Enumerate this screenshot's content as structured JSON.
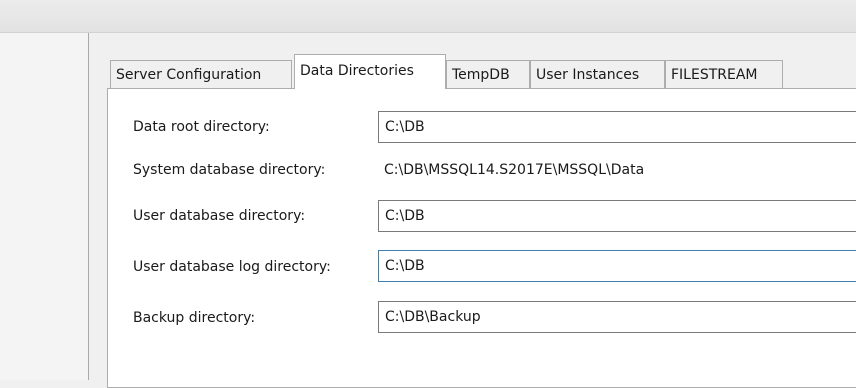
{
  "tabs": [
    {
      "id": "server-configuration",
      "label": "Server Configuration",
      "active": false
    },
    {
      "id": "data-directories",
      "label": "Data Directories",
      "active": true
    },
    {
      "id": "tempdb",
      "label": "TempDB",
      "active": false
    },
    {
      "id": "user-instances",
      "label": "User Instances",
      "active": false
    },
    {
      "id": "filestream",
      "label": "FILESTREAM",
      "active": false
    }
  ],
  "fields": {
    "data_root": {
      "label": "Data root directory:",
      "value": "C:\\DB"
    },
    "system_db": {
      "label": "System database directory:",
      "value": "C:\\DB\\MSSQL14.S2017E\\MSSQL\\Data"
    },
    "user_db": {
      "label": "User database directory:",
      "value": "C:\\DB"
    },
    "user_db_log": {
      "label": "User database log directory:",
      "value": "C:\\DB"
    },
    "backup": {
      "label": "Backup directory:",
      "value": "C:\\DB\\Backup"
    }
  },
  "colors": {
    "window_bg": "#f0f0f0",
    "panel_bg": "#ffffff",
    "border": "#adadad",
    "focus_border": "#3c7fb1"
  }
}
